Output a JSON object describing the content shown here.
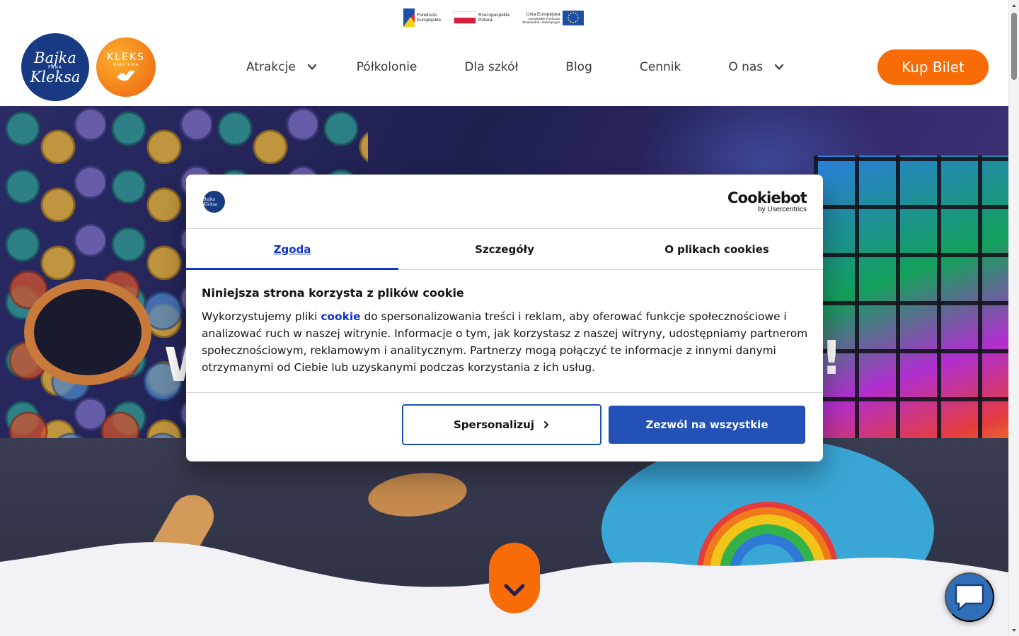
{
  "eu_bar": {
    "funds_label_1": "Fundusze",
    "funds_label_2": "Europejskie",
    "poland_label_1": "Rzeczpospolita",
    "poland_label_2": "Polska",
    "eu_label_1": "Unia Europejska",
    "eu_label_2": "Europejskie Fundusze",
    "eu_label_3": "Strukturalne i Inwestycyjne"
  },
  "logos": {
    "bajka_line1": "Bajka",
    "bajka_line2": "PANA",
    "bajka_line3": "Kleksa",
    "kleks_line1": "KLEKS",
    "kleks_line2": "MAŁA KINA"
  },
  "nav": {
    "items": [
      {
        "label": "Atrakcje",
        "has_dropdown": true
      },
      {
        "label": "Półkolonie",
        "has_dropdown": false
      },
      {
        "label": "Dla szkół",
        "has_dropdown": false
      },
      {
        "label": "Blog",
        "has_dropdown": false
      },
      {
        "label": "Cennik",
        "has_dropdown": false
      },
      {
        "label": "O nas",
        "has_dropdown": true
      }
    ],
    "buy_label": "Kup Bilet"
  },
  "hero": {
    "title_left": "W",
    "title_right": "!"
  },
  "cookie_dialog": {
    "logo_text": "Bajka Kleksa",
    "brand_name": "Cookiebot",
    "brand_sub": "by Usercentrics",
    "tabs": [
      {
        "label": "Zgoda",
        "active": true
      },
      {
        "label": "Szczegóły",
        "active": false
      },
      {
        "label": "O plikach cookies",
        "active": false
      }
    ],
    "heading": "Niniejsza strona korzysta z plików cookie",
    "body_before_link": "Wykorzystujemy pliki ",
    "body_link": "cookie",
    "body_after_link": " do spersonalizowania treści i reklam, aby oferować funkcje społecznościowe i analizować ruch w naszej witrynie. Informacje o tym, jak korzystasz z naszej witryny, udostępniamy partnerom społecznościowym, reklamowym i analitycznym. Partnerzy mogą połączyć te informacje z innymi danymi otrzymanymi od Ciebie lub uzyskanymi podczas korzystania z ich usług.",
    "customize_label": "Spersonalizuj",
    "allow_all_label": "Zezwól na wszystkie"
  },
  "colors": {
    "brand_orange": "#f86c08",
    "cookiebot_blue": "#1032cf",
    "allow_button_blue": "#2351b7",
    "logo_navy": "#183a83"
  }
}
